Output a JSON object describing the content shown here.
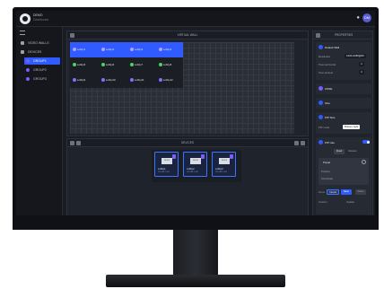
{
  "app": {
    "brand": "DEMO",
    "brand_sub": "Dashboard",
    "user_initials": "DM"
  },
  "sidebar": {
    "items": [
      {
        "label": "VIDEO WALLS"
      },
      {
        "label": "DEVICES"
      },
      {
        "label": "GROUP1"
      },
      {
        "label": "GROUP2"
      },
      {
        "label": "GROUP3"
      }
    ]
  },
  "wall": {
    "title": "VIRTUAL WALL",
    "tiles": [
      [
        "Lobby1",
        "Lobby2",
        "Lobby3",
        "Lobby4"
      ],
      [
        "Lobby5",
        "Lobby6",
        "Lobby7",
        "Lobby8"
      ],
      [
        "Lobby9",
        "Lobby10",
        "Lobby11",
        "Lobby12"
      ]
    ]
  },
  "devices": {
    "title": "DEVICES",
    "cards": [
      {
        "name": "Lobby1",
        "sub": "192.168.1.101",
        "screen": "DEVICE"
      },
      {
        "name": "Lobby2",
        "sub": "192.168.1.102",
        "screen": "DEVICE"
      },
      {
        "name": "Lobby3",
        "sub": "192.168.1.103",
        "screen": "DEVICE"
      }
    ]
  },
  "props": {
    "title": "PROPERTIES",
    "sec1_title": "Default Wall",
    "rows": [
      {
        "label": "Resolution",
        "value": "1920x1080@60"
      },
      {
        "label": "Tiles Horizontal",
        "value": "4"
      },
      {
        "label": "Tiles Vertical",
        "value": "3"
      }
    ],
    "zone_label": "ZONE",
    "size_label": "Size",
    "pip_label": "PIP Size",
    "pip_mode_label": "PIP mode",
    "pip_mode_value": "Bottom-right",
    "pip_use_label": "PIP Use",
    "tab_fixed": "Fixed",
    "tab_relative": "Relative",
    "box_title": "Preset",
    "box_line1": "Position",
    "box_line2": "Size/Scale",
    "save_label": "Save",
    "cancel_label": "Cancel",
    "reset_label": "Reset",
    "zoom_label": "Zoom",
    "extra_label": "Custom",
    "foot_label": "Update"
  }
}
